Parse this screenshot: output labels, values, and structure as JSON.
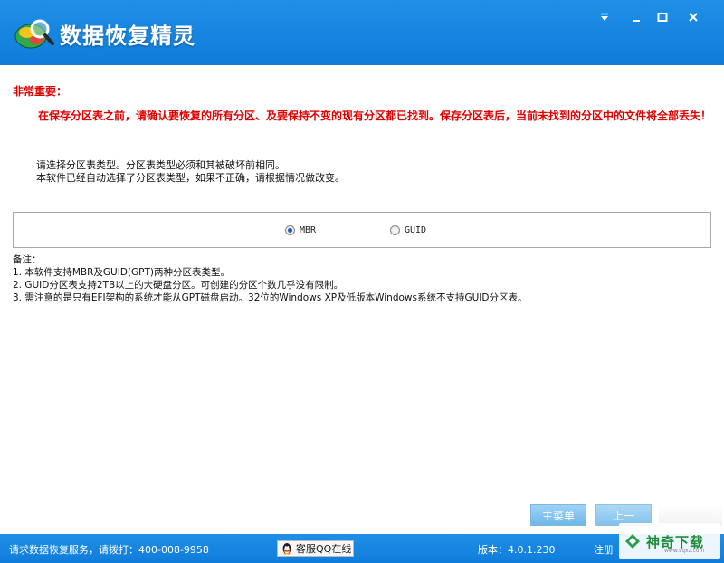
{
  "app": {
    "title": "数据恢复精灵"
  },
  "window_controls": {
    "menu_icon": "triangle-down-icon",
    "min_icon": "minimize-icon",
    "max_icon": "maximize-icon",
    "close_icon": "close-icon"
  },
  "warning": {
    "title": "非常重要：",
    "text": "在保存分区表之前，请确认要恢复的所有分区、及要保持不变的现有分区都已找到。保存分区表后，当前未找到的分区中的文件将全部丢失！",
    "color": "#e00000"
  },
  "hint": {
    "line1": "请选择分区表类型。分区表类型必须和其被破坏前相同。",
    "line2": "本软件已经自动选择了分区表类型，如果不正确，请根据情况做改变。"
  },
  "partition_type": {
    "options": [
      "MBR",
      "GUID"
    ],
    "selected": "MBR"
  },
  "notes": {
    "header": "备注：",
    "items": [
      "1.  本软件支持MBR及GUID(GPT)两种分区表类型。",
      "2.  GUID分区表支持2TB以上的大硬盘分区。可创建的分区个数几乎没有限制。",
      "3.  需注意的是只有EFI架构的系统才能从GPT磁盘启动。32位的Windows XP及低版本Windows系统不支持GUID分区表。"
    ]
  },
  "buttons": {
    "main_menu": "主菜单",
    "prev": "上一"
  },
  "statusbar": {
    "service": "请求数据恢复服务，请拨打：400-008-9958",
    "qq": "客服QQ在线",
    "version": "版本：4.0.1.230",
    "register": "注册"
  },
  "watermark": {
    "text": "神奇下载",
    "sub": "www.sqxz.com"
  },
  "colors": {
    "titlebar": "#1f8fe6",
    "accent_button": "#6eb7ea"
  }
}
